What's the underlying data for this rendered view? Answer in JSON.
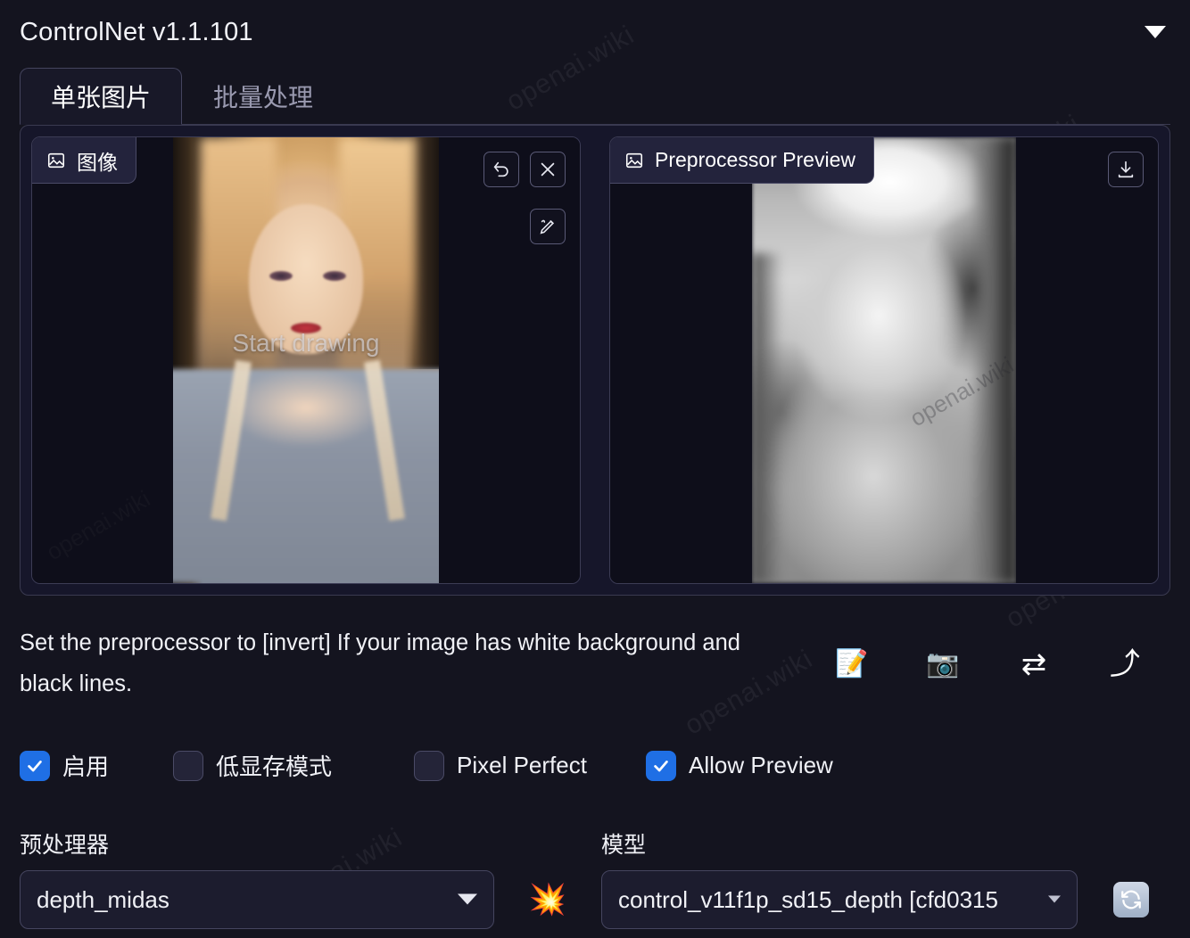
{
  "header": {
    "title": "ControlNet v1.1.101",
    "collapse_icon": "chevron-down-icon"
  },
  "tabs": [
    {
      "label": "单张图片",
      "active": true
    },
    {
      "label": "批量处理",
      "active": false
    }
  ],
  "image_pane": {
    "badge_label": "图像",
    "badge_icon": "image-icon",
    "overlay_text": "Start drawing",
    "tools": [
      {
        "name": "undo-button",
        "icon": "undo-icon"
      },
      {
        "name": "clear-image-button",
        "icon": "close-icon"
      },
      {
        "name": "brush-button",
        "icon": "pen-icon"
      }
    ],
    "watermark": "openai.wiki"
  },
  "preview_pane": {
    "badge_label": "Preprocessor Preview",
    "badge_icon": "image-icon",
    "tools": [
      {
        "name": "download-preview-button",
        "icon": "download-icon"
      }
    ],
    "watermark": "openai.wiki"
  },
  "hint": {
    "text": "Set the preprocessor to [invert] If your image has white background and black lines.",
    "icons": [
      {
        "name": "open-new-canvas-button",
        "glyph": "📝"
      },
      {
        "name": "webcam-button",
        "glyph": "📷"
      },
      {
        "name": "mirror-webcam-button",
        "glyph": "⇄"
      },
      {
        "name": "send-dimensions-button",
        "glyph": "⤴"
      }
    ]
  },
  "checkboxes": [
    {
      "label": "启用",
      "checked": true,
      "name": "enable-checkbox"
    },
    {
      "label": "低显存模式",
      "checked": false,
      "name": "low-vram-checkbox"
    },
    {
      "label": "Pixel Perfect",
      "checked": false,
      "name": "pixel-perfect-checkbox"
    },
    {
      "label": "Allow Preview",
      "checked": true,
      "name": "allow-preview-checkbox"
    }
  ],
  "preprocessor": {
    "label": "预处理器",
    "value": "depth_midas",
    "run_icon": "💥"
  },
  "model": {
    "label": "模型",
    "value": "control_v11f1p_sd15_depth [cfd0315",
    "refresh_icon": "refresh-icon"
  },
  "colors": {
    "background": "#14141f",
    "panel": "#191930",
    "border": "#3c3c55",
    "accent_checked": "#1f6fe5",
    "text": "#f0f1f6",
    "text_muted": "#9a9ab0"
  }
}
